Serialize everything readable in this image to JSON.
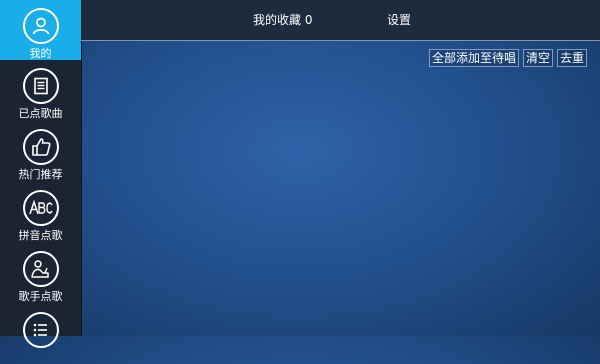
{
  "sidebar": {
    "items": [
      {
        "label": "我的",
        "icon": "user-icon",
        "active": true
      },
      {
        "label": "已点歌曲",
        "icon": "song-list-icon",
        "active": false
      },
      {
        "label": "热门推荐",
        "icon": "thumbs-up-icon",
        "active": false
      },
      {
        "label": "拼音点歌",
        "icon": "abc-pinyin-icon",
        "active": false
      },
      {
        "label": "歌手点歌",
        "icon": "singer-icon",
        "active": false
      },
      {
        "label": "",
        "icon": "list-icon",
        "active": false
      }
    ]
  },
  "header": {
    "tabs": [
      {
        "label": "我的收藏 0"
      },
      {
        "label": "设置"
      }
    ]
  },
  "toolbar": {
    "add_all_label": "全部添加至待唱",
    "clear_label": "清空",
    "dedupe_label": "去重"
  },
  "colors": {
    "active_nav": "#19adea",
    "sidebar_bg": "#1b2433",
    "main_bg": "#23518f"
  }
}
